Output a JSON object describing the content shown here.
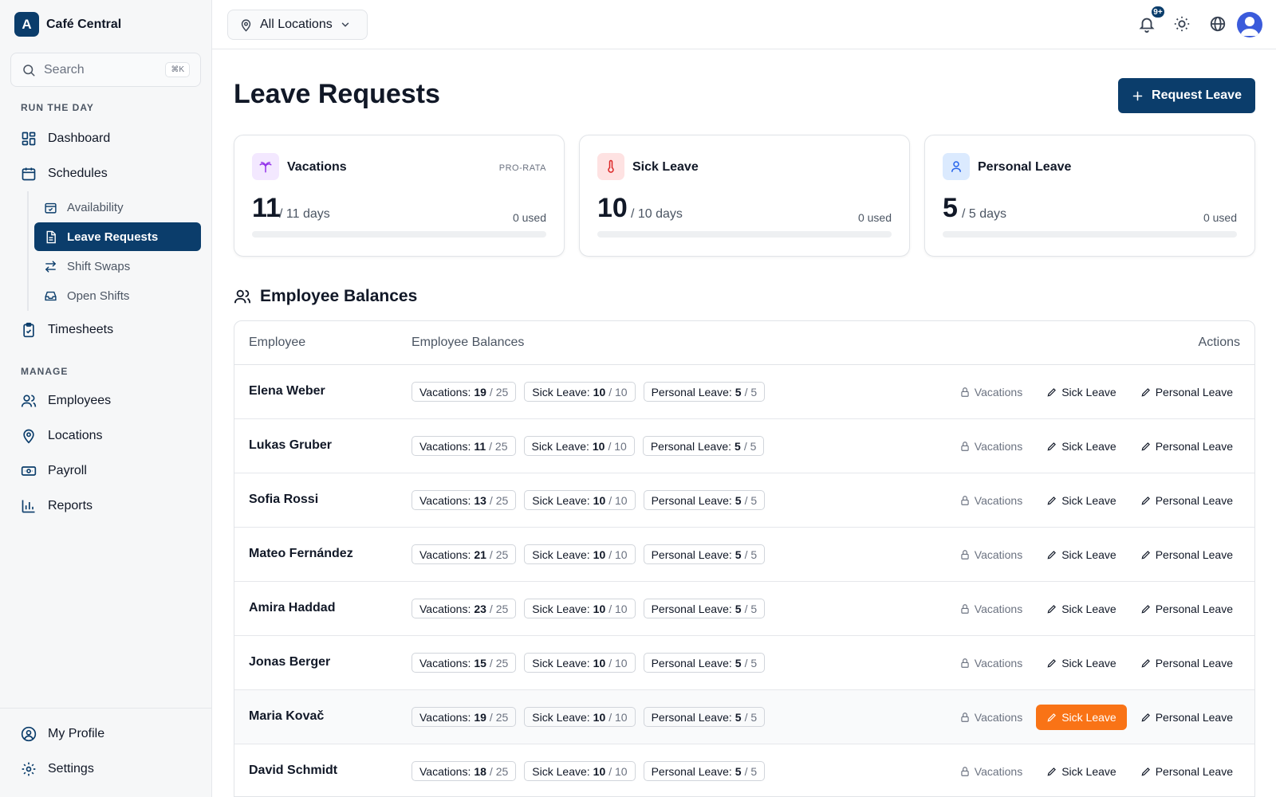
{
  "brand": {
    "logo_letter": "A",
    "name": "Café Central"
  },
  "search": {
    "placeholder": "Search",
    "shortcut": "⌘K"
  },
  "sidebar": {
    "section_run": "RUN THE DAY",
    "dashboard": "Dashboard",
    "schedules": "Schedules",
    "sub": {
      "availability": "Availability",
      "leave_requests": "Leave Requests",
      "shift_swaps": "Shift Swaps",
      "open_shifts": "Open Shifts"
    },
    "timesheets": "Timesheets",
    "section_manage": "MANAGE",
    "employees": "Employees",
    "locations": "Locations",
    "payroll": "Payroll",
    "reports": "Reports",
    "my_profile": "My Profile",
    "settings": "Settings"
  },
  "topbar": {
    "location": "All Locations",
    "notif_badge": "9+"
  },
  "page": {
    "title": "Leave Requests",
    "request_button": "Request Leave"
  },
  "cards": [
    {
      "title": "Vacations",
      "tag": "PRO-RATA",
      "value": "11",
      "of": "/ 11 days",
      "used": "0 used",
      "icon": "palm-tree-icon",
      "icon_bg": "#f3e8ff",
      "icon_color": "#9333ea"
    },
    {
      "title": "Sick Leave",
      "tag": "",
      "value": "10",
      "of": "/ 10 days",
      "used": "0 used",
      "icon": "thermometer-icon",
      "icon_bg": "#fee2e2",
      "icon_color": "#dc2626"
    },
    {
      "title": "Personal Leave",
      "tag": "",
      "value": "5",
      "of": "/ 5 days",
      "used": "0 used",
      "icon": "user-icon",
      "icon_bg": "#dbeafe",
      "icon_color": "#2563eb"
    }
  ],
  "balances": {
    "title": "Employee Balances",
    "columns": {
      "employee": "Employee",
      "balances": "Employee Balances",
      "actions": "Actions"
    },
    "chip_labels": {
      "vac": "Vacations:",
      "sick": "Sick Leave:",
      "pers": "Personal Leave:"
    },
    "actions": {
      "vac": "Vacations",
      "sick": "Sick Leave",
      "pers": "Personal Leave"
    },
    "rows": [
      {
        "name": "Elena Weber",
        "vac": "19",
        "vac_max": "/ 25",
        "sick": "10",
        "sick_max": "/ 10",
        "pers": "5",
        "pers_max": "/ 5"
      },
      {
        "name": "Lukas Gruber",
        "vac": "11",
        "vac_max": "/ 25",
        "sick": "10",
        "sick_max": "/ 10",
        "pers": "5",
        "pers_max": "/ 5"
      },
      {
        "name": "Sofia Rossi",
        "vac": "13",
        "vac_max": "/ 25",
        "sick": "10",
        "sick_max": "/ 10",
        "pers": "5",
        "pers_max": "/ 5"
      },
      {
        "name": "Mateo Fernández",
        "vac": "21",
        "vac_max": "/ 25",
        "sick": "10",
        "sick_max": "/ 10",
        "pers": "5",
        "pers_max": "/ 5"
      },
      {
        "name": "Amira Haddad",
        "vac": "23",
        "vac_max": "/ 25",
        "sick": "10",
        "sick_max": "/ 10",
        "pers": "5",
        "pers_max": "/ 5"
      },
      {
        "name": "Jonas Berger",
        "vac": "15",
        "vac_max": "/ 25",
        "sick": "10",
        "sick_max": "/ 10",
        "pers": "5",
        "pers_max": "/ 5"
      },
      {
        "name": "Maria Kovač",
        "vac": "19",
        "vac_max": "/ 25",
        "sick": "10",
        "sick_max": "/ 10",
        "pers": "5",
        "pers_max": "/ 5",
        "highlight": true
      },
      {
        "name": "David Schmidt",
        "vac": "18",
        "vac_max": "/ 25",
        "sick": "10",
        "sick_max": "/ 10",
        "pers": "5",
        "pers_max": "/ 5"
      }
    ]
  },
  "colors": {
    "brand": "#0b3d6b",
    "accent_hover": "#f97316"
  }
}
